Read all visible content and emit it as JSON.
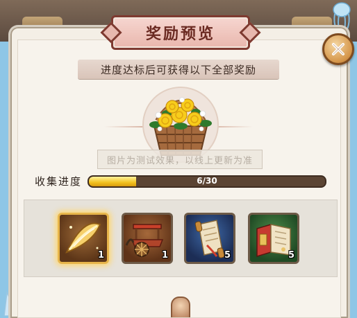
{
  "dialog": {
    "title": "奖励预览",
    "subtitle": "进度达标后可获得以下全部奖励",
    "preview_note": "图片为测试效果，以线上更新为准"
  },
  "progress": {
    "label": "收集进度",
    "current": 6,
    "total": 30,
    "text": "6/30",
    "fraction": 0.2
  },
  "rewards": [
    {
      "name": "golden-feather-item",
      "count": "1",
      "rarity": "gold",
      "icon": "golden-leaf-icon"
    },
    {
      "name": "chariot-item",
      "count": "1",
      "rarity": "orange",
      "icon": "chariot-icon"
    },
    {
      "name": "scroll-item",
      "count": "5",
      "rarity": "blue",
      "icon": "scroll-icon"
    },
    {
      "name": "book-item",
      "count": "5",
      "rarity": "green",
      "icon": "book-icon"
    }
  ],
  "colors": {
    "title_text": "#6b2a22",
    "progress_fill": "#f2c21e",
    "panel_bg": "#f4efe6",
    "sky": "#8ec6e6"
  }
}
